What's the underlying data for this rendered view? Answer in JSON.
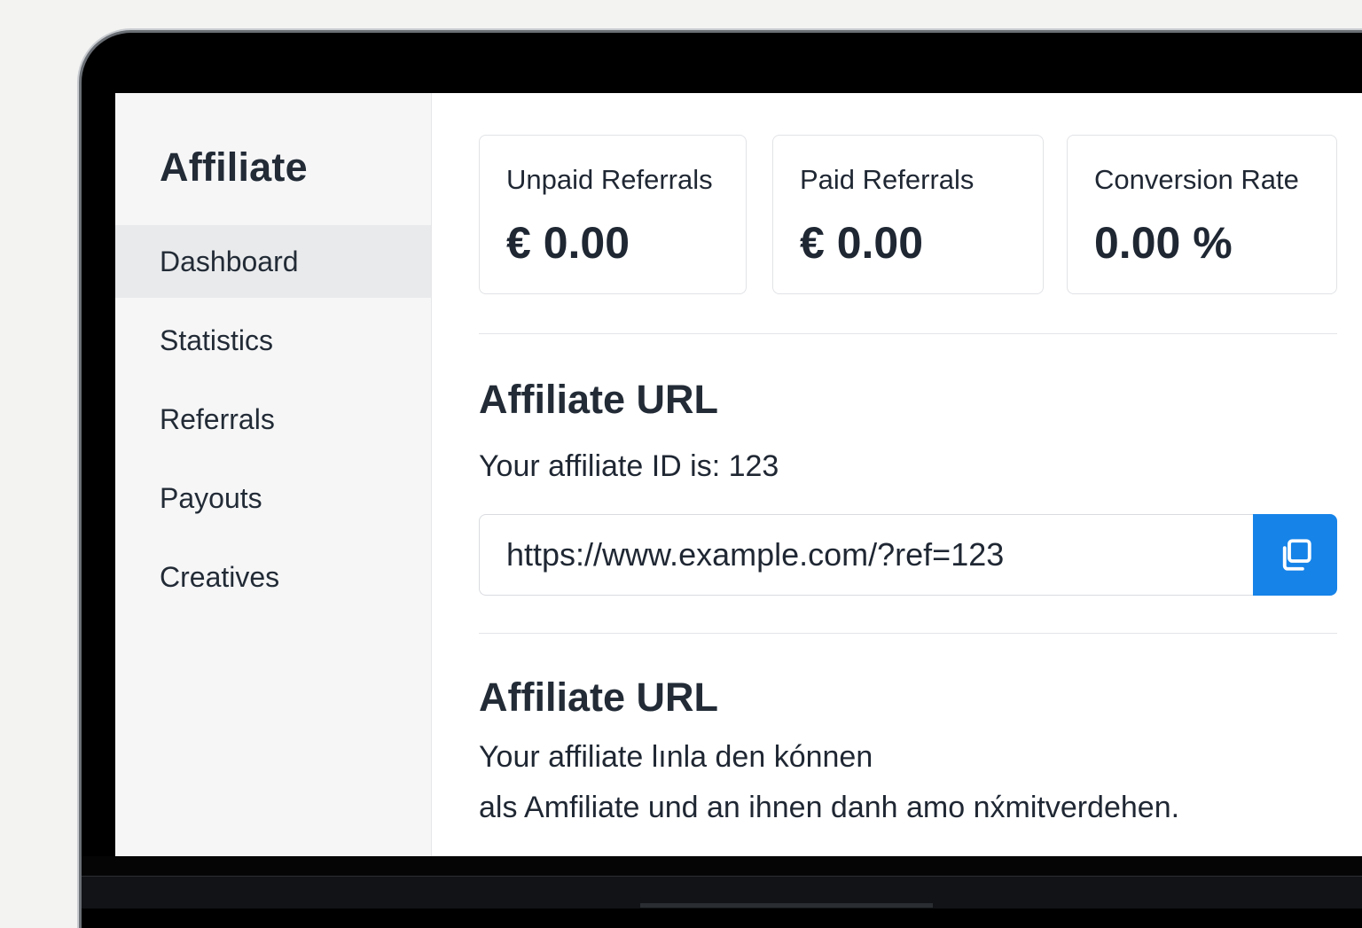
{
  "sidebar": {
    "brand": "Affiliate",
    "items": [
      {
        "label": "Dashboard",
        "active": true
      },
      {
        "label": "Statistics",
        "active": false
      },
      {
        "label": "Referrals",
        "active": false
      },
      {
        "label": "Payouts",
        "active": false
      },
      {
        "label": "Creatives",
        "active": false
      }
    ]
  },
  "cards": [
    {
      "label": "Unpaid Referrals",
      "value": "€ 0.00"
    },
    {
      "label": "Paid Referrals",
      "value": "€ 0.00"
    },
    {
      "label": "Conversion Rate",
      "value": "0.00 %"
    }
  ],
  "affiliate_url": {
    "title": "Affiliate URL",
    "id_text": "Your affiliate ID is: 123",
    "url_value": "https://www.example.com/?ref=123",
    "copy_icon": "copy-icon"
  },
  "second_section": {
    "title": "Affiliate URL",
    "line1": "Your affiliate lınla den kónnen",
    "line2": "als Amfiliate und an ihnen danh amo nx́mitverdehen."
  },
  "colors": {
    "accent": "#1683e8",
    "sidebar_bg": "#f6f6f7",
    "active_item_bg": "#e9eaec",
    "text": "#1f2733"
  }
}
